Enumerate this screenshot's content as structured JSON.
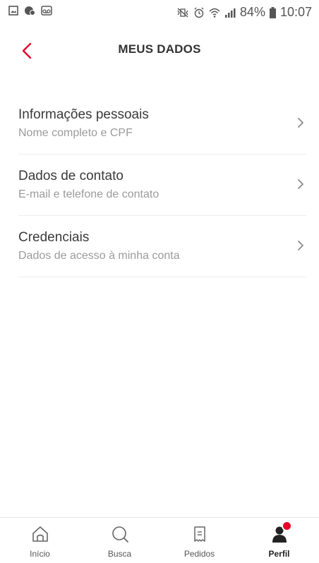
{
  "status_bar": {
    "battery": "84%",
    "time": "10:07"
  },
  "header": {
    "title": "MEUS DADOS"
  },
  "menu": {
    "items": [
      {
        "title": "Informações pessoais",
        "subtitle": "Nome completo e CPF"
      },
      {
        "title": "Dados de contato",
        "subtitle": "E-mail e telefone de contato"
      },
      {
        "title": "Credenciais",
        "subtitle": "Dados de acesso à minha conta"
      }
    ]
  },
  "bottom_nav": {
    "items": [
      {
        "label": "Início",
        "icon": "home-icon"
      },
      {
        "label": "Busca",
        "icon": "search-icon"
      },
      {
        "label": "Pedidos",
        "icon": "orders-icon"
      },
      {
        "label": "Perfil",
        "icon": "profile-icon"
      }
    ],
    "active": "Perfil"
  },
  "colors": {
    "accent": "#e4002b",
    "text_primary": "#3a3a3a",
    "text_secondary": "#9b9b9b",
    "divider": "#eeeeee"
  }
}
